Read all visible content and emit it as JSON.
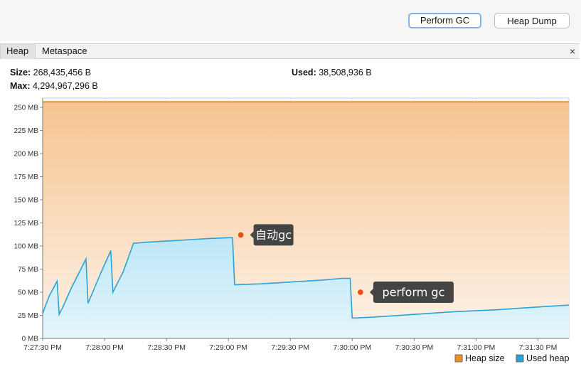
{
  "toolbar": {
    "perform_gc_label": "Perform GC",
    "heap_dump_label": "Heap Dump"
  },
  "tabs": [
    {
      "label": "Heap",
      "active": true
    },
    {
      "label": "Metaspace",
      "active": false
    }
  ],
  "close_glyph": "×",
  "stats": {
    "size_label": "Size:",
    "size_value": "268,435,456 B",
    "max_label": "Max:",
    "max_value": "4,294,967,296 B",
    "used_label": "Used:",
    "used_value": "38,508,936 B"
  },
  "colors": {
    "heap_size": "#e8902a",
    "used_heap": "#2aa3d6",
    "annotation_dot": "#f04a1a",
    "annotation_bg": "#444444"
  },
  "chart_data": {
    "type": "area",
    "y_unit": "MB",
    "ylim": [
      0,
      260
    ],
    "xlim": [
      "7:27:30 PM",
      "7:31:45 PM"
    ],
    "y_ticks": [
      {
        "value": 0,
        "label": "0 MB"
      },
      {
        "value": 25,
        "label": "25 MB"
      },
      {
        "value": 50,
        "label": "50 MB"
      },
      {
        "value": 75,
        "label": "75 MB"
      },
      {
        "value": 100,
        "label": "100 MB"
      },
      {
        "value": 125,
        "label": "125 MB"
      },
      {
        "value": 150,
        "label": "150 MB"
      },
      {
        "value": 175,
        "label": "175 MB"
      },
      {
        "value": 200,
        "label": "200 MB"
      },
      {
        "value": 225,
        "label": "225 MB"
      },
      {
        "value": 250,
        "label": "250 MB"
      }
    ],
    "x_ticks": [
      "7:27:30 PM",
      "7:28:00 PM",
      "7:28:30 PM",
      "7:29:00 PM",
      "7:29:30 PM",
      "7:30:00 PM",
      "7:30:30 PM",
      "7:31:00 PM",
      "7:31:30 PM"
    ],
    "grid": true,
    "legend_position": "bottom-right",
    "series": [
      {
        "name": "Heap size",
        "color": "#e8902a",
        "points": [
          [
            "7:27:30 PM",
            256
          ],
          [
            "7:31:45 PM",
            256
          ]
        ]
      },
      {
        "name": "Used heap",
        "color": "#2aa3d6",
        "points": [
          [
            "7:27:30 PM",
            27
          ],
          [
            "7:27:33 PM",
            45
          ],
          [
            "7:27:37 PM",
            62
          ],
          [
            "7:27:38 PM",
            26
          ],
          [
            "7:27:40 PM",
            35
          ],
          [
            "7:27:44 PM",
            55
          ],
          [
            "7:27:51 PM",
            86
          ],
          [
            "7:27:52 PM",
            38
          ],
          [
            "7:27:58 PM",
            70
          ],
          [
            "7:28:03 PM",
            95
          ],
          [
            "7:28:04 PM",
            50
          ],
          [
            "7:28:09 PM",
            72
          ],
          [
            "7:28:14 PM",
            103
          ],
          [
            "7:28:20 PM",
            104
          ],
          [
            "7:28:35 PM",
            106
          ],
          [
            "7:28:50 PM",
            108
          ],
          [
            "7:29:00 PM",
            109
          ],
          [
            "7:29:02 PM",
            109
          ],
          [
            "7:29:03 PM",
            58
          ],
          [
            "7:29:15 PM",
            59
          ],
          [
            "7:29:30 PM",
            61
          ],
          [
            "7:29:45 PM",
            63
          ],
          [
            "7:29:55 PM",
            65
          ],
          [
            "7:29:59 PM",
            65
          ],
          [
            "7:30:00 PM",
            22
          ],
          [
            "7:30:10 PM",
            23
          ],
          [
            "7:30:30 PM",
            26
          ],
          [
            "7:30:50 PM",
            29
          ],
          [
            "7:31:10 PM",
            31
          ],
          [
            "7:31:30 PM",
            34
          ],
          [
            "7:31:45 PM",
            36
          ]
        ]
      }
    ],
    "annotations": [
      {
        "text": "自动gc",
        "x": "7:29:06 PM",
        "y": 112
      },
      {
        "text": "perform gc",
        "x": "7:30:04 PM",
        "y": 50
      }
    ],
    "legend": [
      "Heap size",
      "Used heap"
    ]
  }
}
